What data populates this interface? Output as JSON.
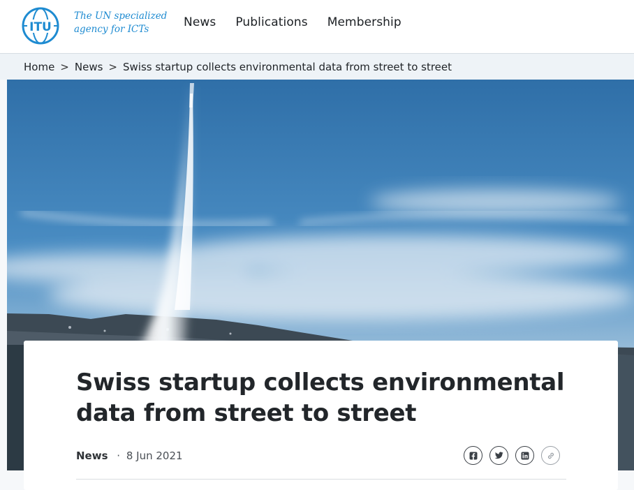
{
  "header": {
    "tagline_line1": "The UN specialized",
    "tagline_line2": "agency for ICTs",
    "nav": [
      "News",
      "Publications",
      "Membership"
    ]
  },
  "logo": {
    "text": "ITU",
    "color": "#1e8bd1"
  },
  "breadcrumb": {
    "separator": ">",
    "items": [
      "Home",
      "News",
      "Swiss startup collects environmental data from street to street"
    ]
  },
  "hero": {
    "description": "Geneva Jet d'Eau fountain over the lake under a blue sky"
  },
  "article": {
    "title": "Swiss startup collects environmental data from street to street",
    "category": "News",
    "date_sep": "·",
    "date": "8 Jun 2021"
  },
  "share": {
    "icons": [
      "facebook-icon",
      "twitter-icon",
      "linkedin-icon",
      "link-icon"
    ]
  },
  "colors": {
    "brand_blue": "#1e8bd1",
    "breadcrumb_bg": "#eef3f7",
    "text_dark": "#22262a"
  }
}
